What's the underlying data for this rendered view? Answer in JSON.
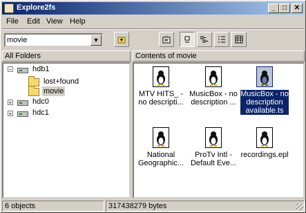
{
  "window": {
    "title": "Explore2fs"
  },
  "titlebar_buttons": [
    "_",
    "□",
    "✕"
  ],
  "menu": [
    "File",
    "Edit",
    "View",
    "Help"
  ],
  "location": {
    "value": "movie"
  },
  "left_pane": {
    "header": "All Folders"
  },
  "right_pane": {
    "header": "Contents of movie"
  },
  "tree": [
    {
      "label": "hdb1",
      "expanded": true
    },
    {
      "label": "lost+found"
    },
    {
      "label": "movie",
      "selected": true
    },
    {
      "label": "hdc0",
      "expanded": false
    },
    {
      "label": "hdc1",
      "expanded": false
    }
  ],
  "files": [
    {
      "label": "MTV HITS_ - no descripti...",
      "selected": false
    },
    {
      "label": "MusicBox - no description ...",
      "selected": false
    },
    {
      "label": "MusicBox - no description available.ts",
      "selected": true
    },
    {
      "label": "National Geographic...",
      "selected": false
    },
    {
      "label": "ProTv Intl - Default Eve...",
      "selected": false
    },
    {
      "label": "recordings.epl",
      "selected": false
    }
  ],
  "status": {
    "objects": "6 objects",
    "bytes": "317438279 bytes"
  }
}
